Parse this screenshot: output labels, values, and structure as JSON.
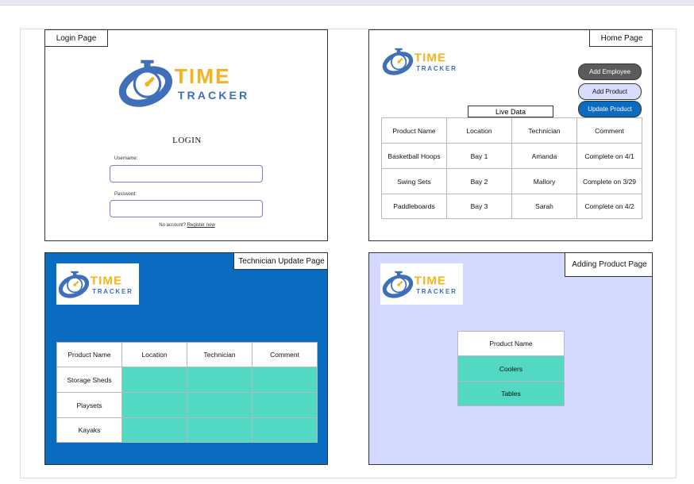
{
  "logo": {
    "top_word": "TIME",
    "bottom_word": "TRACKER",
    "colors": {
      "blue": "#3e6fb8",
      "yellow": "#f5b21a"
    }
  },
  "login_panel": {
    "tag": "Login Page",
    "heading": "LOGIN",
    "username_label": "Username:",
    "password_label": "Password:",
    "signup_prefix": "No account?",
    "signup_link": "Register now"
  },
  "home_panel": {
    "tag": "Home Page",
    "buttons": {
      "add_employee": "Add Employee",
      "add_product": "Add Product",
      "update_product": "Update Product"
    },
    "live_data_label": "Live Data",
    "columns": [
      "Product Name",
      "Location",
      "Technician",
      "Comment"
    ],
    "rows": [
      [
        "Basketball Hoops",
        "Bay 1",
        "Amanda",
        "Complete on 4/1"
      ],
      [
        "Swing Sets",
        "Bay 2",
        "Mallory",
        "Complete on 3/29"
      ],
      [
        "Paddleboards",
        "Bay 3",
        "Sarah",
        "Complete on 4/2"
      ]
    ]
  },
  "tech_panel": {
    "tag": "Technician Update Page",
    "columns": [
      "Product Name",
      "Location",
      "Technician",
      "Comment"
    ],
    "rows": [
      [
        "Storage Sheds",
        "",
        "",
        ""
      ],
      [
        "Playsets",
        "",
        "",
        ""
      ],
      [
        "Kayaks",
        "",
        "",
        ""
      ]
    ]
  },
  "product_panel": {
    "tag": "Adding Product Page",
    "header": "Product Name",
    "rows": [
      "Coolers",
      "Tables"
    ]
  },
  "colors": {
    "tech_bg": "#0a6cc0",
    "product_bg": "#d4d9ff",
    "teal": "#52d8c3",
    "dark_button": "#5b5b5b",
    "light_button": "#d8dcff",
    "blue_button": "#0a6cc0"
  }
}
